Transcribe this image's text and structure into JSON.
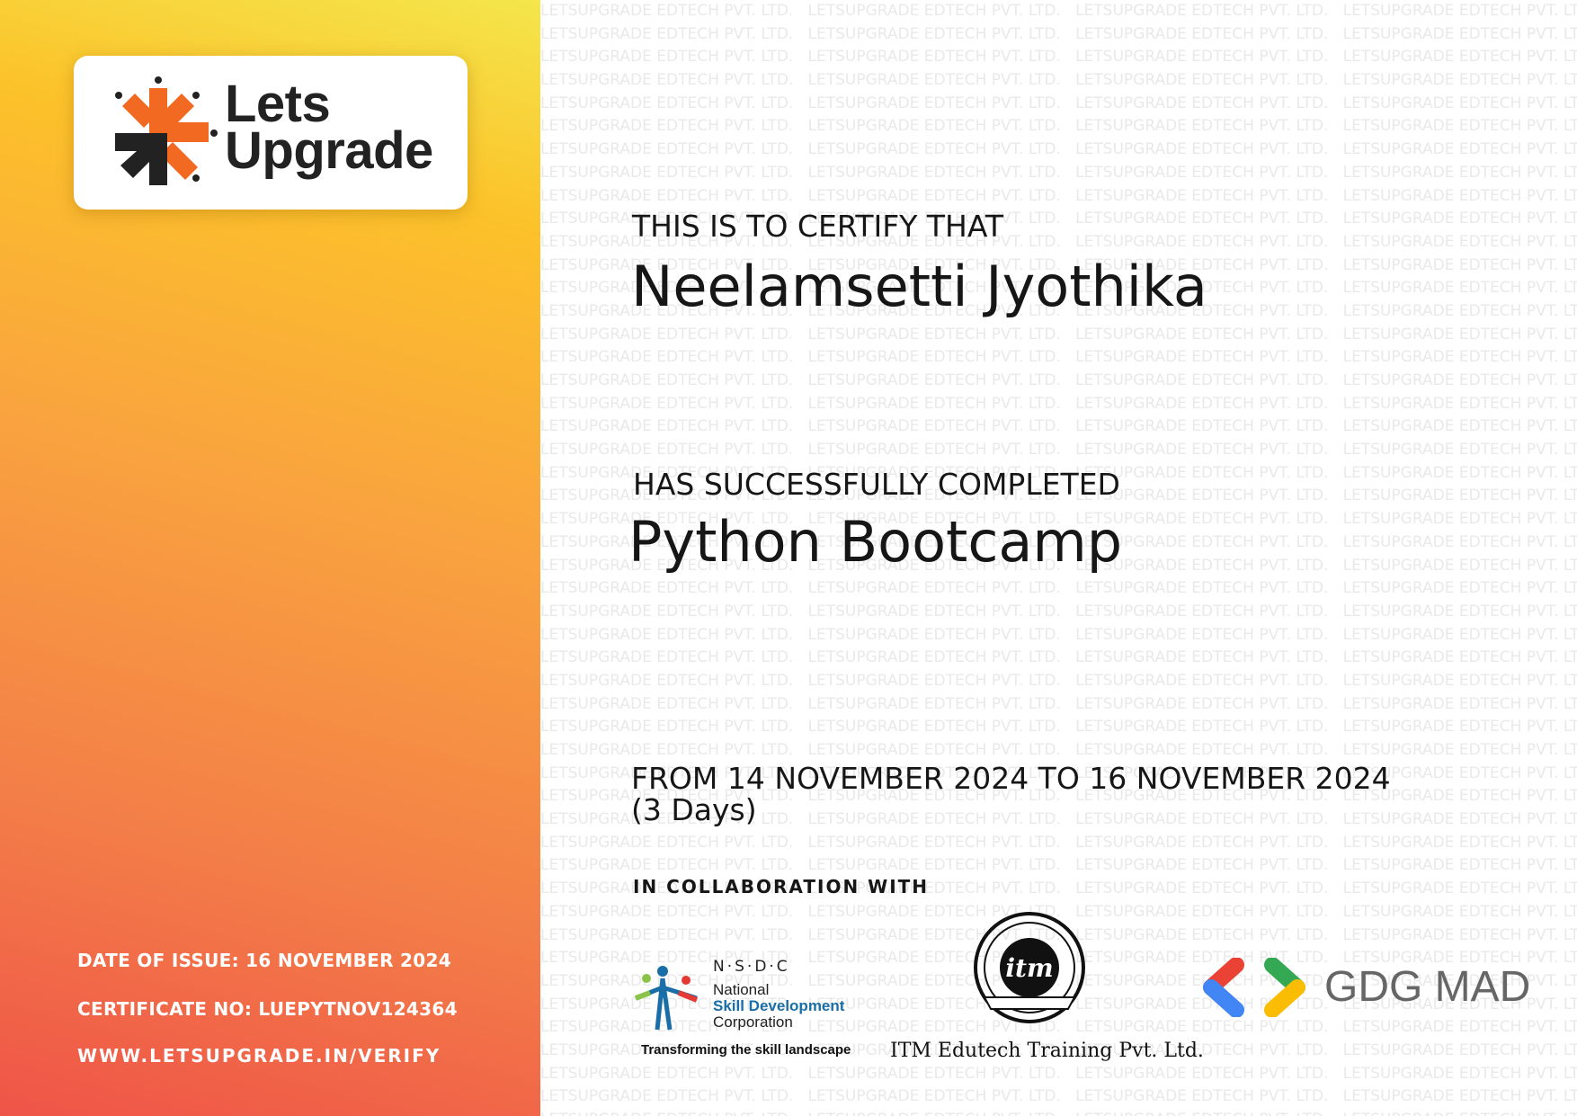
{
  "brand": {
    "logo_text_line1": "Lets",
    "logo_text_line2": "Upgrade",
    "colors": {
      "orange": "#f26a21",
      "dark": "#222222"
    }
  },
  "watermark": "LETSUPGRADE EDTECH PVT. LTD.",
  "certificate": {
    "intro": "THIS IS TO CERTIFY THAT",
    "recipient": "Neelamsetti Jyothika",
    "completed_label": "HAS SUCCESSFULLY COMPLETED",
    "course": "Python Bootcamp",
    "period": "FROM 14 NOVEMBER 2024 TO 16 NOVEMBER 2024",
    "duration": "(3 Days)",
    "collab_label": "IN COLLABORATION WITH"
  },
  "footer": {
    "date_of_issue": "DATE OF ISSUE: 16 NOVEMBER 2024",
    "certificate_no": "CERTIFICATE NO: LUEPYTNOV124364",
    "verify_url": "WWW.LETSUPGRADE.IN/VERIFY"
  },
  "partners": {
    "nsdc": {
      "abbr": "N·S·D·C",
      "line1": "National",
      "line2": "Skill Development",
      "line3": "Corporation",
      "tagline": "Transforming the skill landscape"
    },
    "itm": {
      "seal_text": "itm",
      "name": "ITM Edutech Training Pvt. Ltd."
    },
    "gdg": {
      "name": "GDG MAD"
    }
  }
}
